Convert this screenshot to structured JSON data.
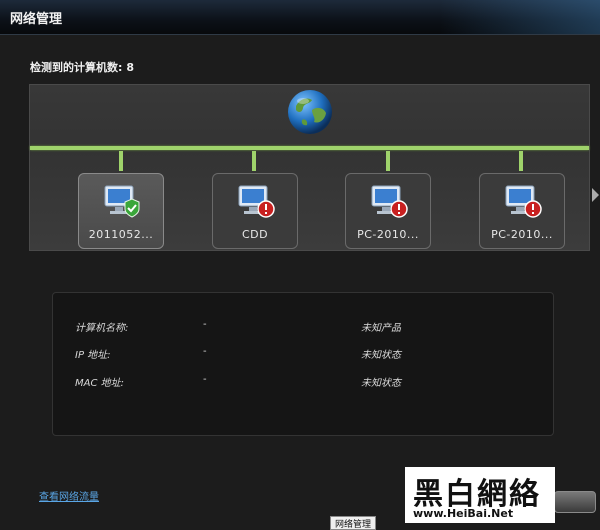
{
  "window": {
    "title": "网络管理"
  },
  "network": {
    "count_label": "检测到的计算机数:",
    "count": "8",
    "computers": [
      {
        "name": "2011052...",
        "status": "ok"
      },
      {
        "name": "CDD",
        "status": "error"
      },
      {
        "name": "PC-2010...",
        "status": "error"
      },
      {
        "name": "PC-2010...",
        "status": "error"
      }
    ]
  },
  "details": {
    "rows": [
      {
        "key": "计算机名称:",
        "value": "-",
        "status": "未知产品"
      },
      {
        "key": "IP 地址:",
        "value": "-",
        "status": "未知状态"
      },
      {
        "key": "MAC 地址:",
        "value": "-",
        "status": "未知状态"
      }
    ]
  },
  "footer": {
    "link": "查看网络流量",
    "watermark_top": "黑白網絡",
    "watermark_bottom": "www.HeiBai.Net",
    "bottom_tab": "网络管理"
  },
  "colors": {
    "link_line": "#9fd36b",
    "link_text": "#5aa6e6",
    "ok_badge": "#3aa63a",
    "error_badge": "#c82020"
  }
}
